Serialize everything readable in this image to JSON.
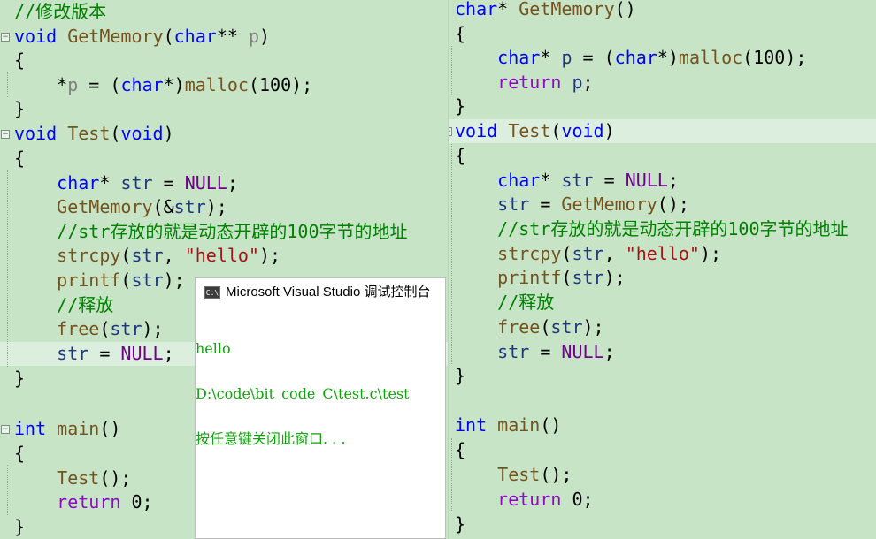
{
  "left_editor": {
    "lines": [
      {
        "text": "//修改版本"
      },
      {
        "text": "void GetMemory(char** p)"
      },
      {
        "text": "{"
      },
      {
        "text": "    *p = (char*)malloc(100);"
      },
      {
        "text": "}"
      },
      {
        "text": "void Test(void)"
      },
      {
        "text": "{"
      },
      {
        "text": "    char* str = NULL;"
      },
      {
        "text": "    GetMemory(&str);"
      },
      {
        "text": "    //str存放的就是动态开辟的100字节的地址"
      },
      {
        "text": "    strcpy(str, \"hello\");"
      },
      {
        "text": "    printf(str);"
      },
      {
        "text": "    //释放"
      },
      {
        "text": "    free(str);"
      },
      {
        "text": "    str = NULL;"
      },
      {
        "text": "}"
      },
      {
        "text": ""
      },
      {
        "text": "int main()"
      },
      {
        "text": "{"
      },
      {
        "text": "    Test();"
      },
      {
        "text": "    return 0;"
      },
      {
        "text": "}"
      }
    ]
  },
  "right_editor": {
    "lines": [
      {
        "text": "char* GetMemory()"
      },
      {
        "text": "{"
      },
      {
        "text": "    char* p = (char*)malloc(100);"
      },
      {
        "text": "    return p;"
      },
      {
        "text": "}"
      },
      {
        "text": "void Test(void)"
      },
      {
        "text": "{"
      },
      {
        "text": "    char* str = NULL;"
      },
      {
        "text": "    str = GetMemory();"
      },
      {
        "text": "    //str存放的就是动态开辟的100字节的地址"
      },
      {
        "text": "    strcpy(str, \"hello\");"
      },
      {
        "text": "    printf(str);"
      },
      {
        "text": "    //释放"
      },
      {
        "text": "    free(str);"
      },
      {
        "text": "    str = NULL;"
      },
      {
        "text": "}"
      },
      {
        "text": ""
      },
      {
        "text": "int main()"
      },
      {
        "text": "{"
      },
      {
        "text": "    Test();"
      },
      {
        "text": "    return 0;"
      },
      {
        "text": "}"
      }
    ]
  },
  "console": {
    "icon_text": "C:\\",
    "title": "Microsoft Visual Studio 调试控制台",
    "output": [
      "hello",
      "D:\\code\\bit_code_C\\test.c\\test",
      "按任意键关闭此窗口. . ."
    ]
  },
  "colors": {
    "editor_bg": "#c7e4c7",
    "current_line": "#dceedd",
    "keyword": "#0000ff",
    "function": "#74531f",
    "comment": "#008000",
    "string": "#a31515",
    "console_text": "#13a10e"
  }
}
